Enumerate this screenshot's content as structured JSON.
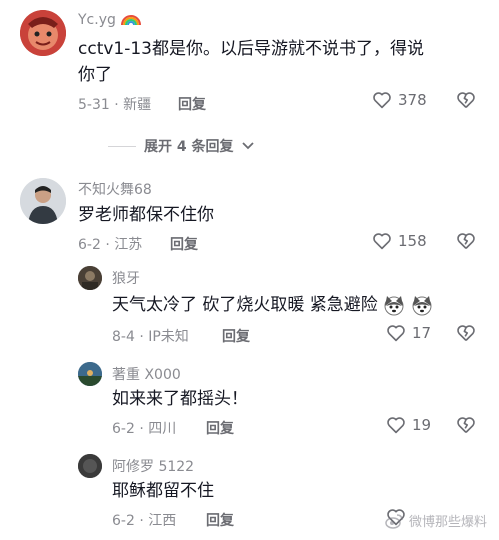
{
  "comments": [
    {
      "username": "Yc.yg",
      "username_badge": "rainbow-icon",
      "text": "cctv1-13都是你。以后导游就不说书了，得说你了",
      "date": "5-31",
      "location": "新疆",
      "reply_label": "回复",
      "likes": "378",
      "avatar_color": "#c0392b"
    },
    {
      "username": "不知火舞68",
      "text": "罗老师都保不住你",
      "date": "6-2",
      "location": "江苏",
      "reply_label": "回复",
      "likes": "158",
      "avatar_color": "#5b6b7a"
    }
  ],
  "expand": {
    "label": "展开 4 条回复"
  },
  "replies": [
    {
      "username": "狼牙",
      "text": "天气太冷了 砍了烧火取暖 紧急避险",
      "date": "8-4",
      "location": "IP未知",
      "reply_label": "回复",
      "likes": "17",
      "avatar_color": "#4a4036",
      "emojis": [
        "husky-emoji",
        "husky-emoji"
      ]
    },
    {
      "username": "著重 X000",
      "text": "如来来了都摇头！",
      "date": "6-2",
      "location": "四川",
      "reply_label": "回复",
      "likes": "19",
      "avatar_color": "#3d6a8c"
    },
    {
      "username": "阿修罗 5122",
      "text": "耶稣都留不住",
      "date": "6-2",
      "location": "江西",
      "reply_label": "回复",
      "likes": "",
      "avatar_color": "#3a3a3a"
    }
  ],
  "watermark": {
    "text": "微博那些爆料"
  },
  "colors": {
    "text": "#161823",
    "muted": "#8a8b91",
    "icon": "#6b6c72"
  }
}
